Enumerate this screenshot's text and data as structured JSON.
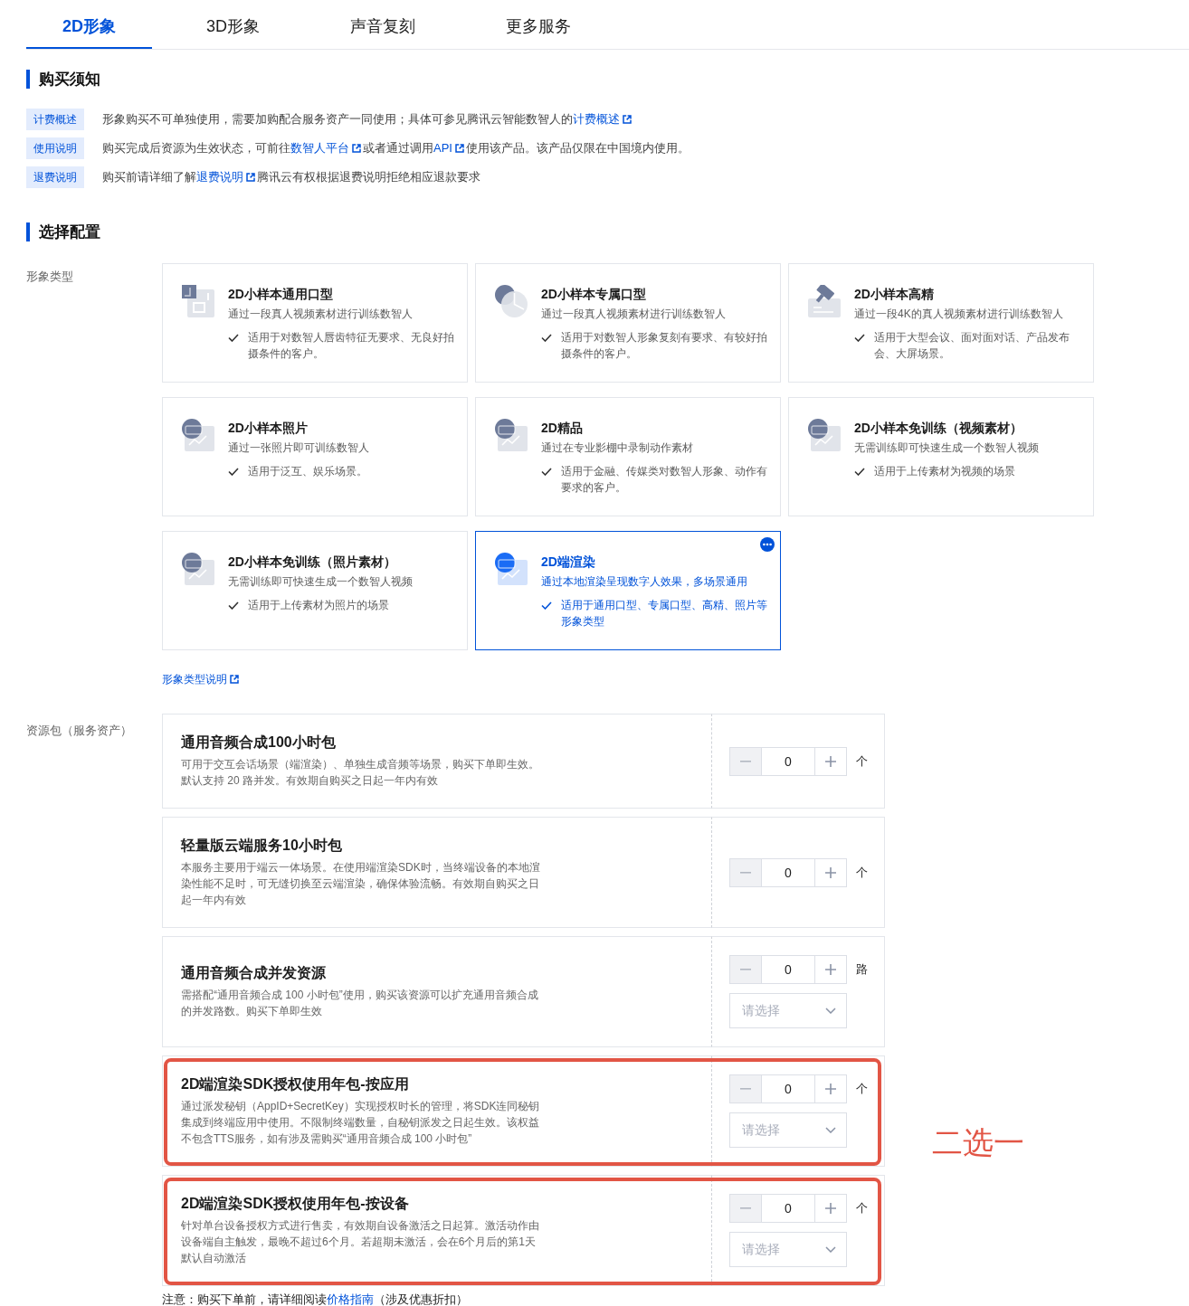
{
  "tabs": [
    {
      "label": "2D形象",
      "selected": true
    },
    {
      "label": "3D形象",
      "selected": false
    },
    {
      "label": "声音复刻",
      "selected": false
    },
    {
      "label": "更多服务",
      "selected": false
    }
  ],
  "purchase_notice": {
    "title": "购买须知",
    "items": [
      {
        "tag": "计费概述",
        "parts": [
          {
            "kind": "text",
            "text": "形象购买不可单独使用，需要加购配合服务资产一同使用；具体可参见腾讯云智能数智人的"
          },
          {
            "kind": "link",
            "text": "计费概述",
            "external": true
          }
        ]
      },
      {
        "tag": "使用说明",
        "parts": [
          {
            "kind": "text",
            "text": "购买完成后资源为生效状态，可前往"
          },
          {
            "kind": "link",
            "text": "数智人平台",
            "external": true
          },
          {
            "kind": "text",
            "text": "或者通过调用"
          },
          {
            "kind": "link",
            "text": "API",
            "external": true
          },
          {
            "kind": "text",
            "text": "使用该产品。该产品仅限在中国境内使用。"
          }
        ]
      },
      {
        "tag": "退费说明",
        "parts": [
          {
            "kind": "text",
            "text": "购买前请详细了解"
          },
          {
            "kind": "link",
            "text": "退费说明",
            "external": true
          },
          {
            "kind": "text",
            "text": "腾讯云有权根据退费说明拒绝相应退款要求"
          }
        ]
      }
    ]
  },
  "config": {
    "title": "选择配置",
    "avatar_type": {
      "label": "形象类型",
      "cards": [
        {
          "kind": "document",
          "title": "2D小样本通用口型",
          "description": "通过一段真人视频素材进行训练数智人",
          "feature": "适用于对数智人唇齿特征无要求、无良好拍摄条件的客户。",
          "selected": false
        },
        {
          "kind": "pie",
          "title": "2D小样本专属口型",
          "description": "通过一段真人视频素材进行训练数智人",
          "feature": "适用于对数智人形象复刻有要求、有较好拍摄条件的客户。",
          "selected": false
        },
        {
          "kind": "hammer",
          "title": "2D小样本高精",
          "description": "通过一段4K的真人视频素材进行训练数智人",
          "feature": "适用于大型会议、面对面对话、产品发布会、大屏场景。",
          "selected": false
        },
        {
          "kind": "image",
          "title": "2D小样本照片",
          "description": "通过一张照片即可训练数智人",
          "feature": "适用于泛互、娱乐场景。",
          "selected": false
        },
        {
          "kind": "image",
          "title": "2D精品",
          "description": "通过在专业影棚中录制动作素材",
          "feature": "适用于金融、传媒类对数智人形象、动作有要求的客户。",
          "selected": false
        },
        {
          "kind": "image",
          "title": "2D小样本免训练（视频素材）",
          "description": "无需训练即可快速生成一个数智人视频",
          "feature": "适用于上传素材为视频的场景",
          "selected": false
        },
        {
          "kind": "image",
          "title": "2D小样本免训练（照片素材）",
          "description": "无需训练即可快速生成一个数智人视频",
          "feature": "适用于上传素材为照片的场景",
          "selected": false
        },
        {
          "kind": "image",
          "title": "2D端渲染",
          "description": "通过本地渲染呈现数字人效果，多场景通用",
          "feature": "适用于通用口型、专属口型、高精、照片等形象类型",
          "selected": true
        }
      ],
      "help_link": {
        "text": "形象类型说明",
        "external": true
      }
    },
    "resource_packs": {
      "label": "资源包（服务资产）",
      "annotation": "二选一",
      "items": [
        {
          "title": "通用音频合成100小时包",
          "description": "可用于交互会话场景（端渲染）、单独生成音频等场景，购买下单即生效。默认支持 20 路并发。有效期自购买之日起一年内有效",
          "quantity": "0",
          "decrement_disabled": true,
          "unit": "个",
          "highlighted": false
        },
        {
          "title": "轻量版云端服务10小时包",
          "description": "本服务主要用于端云一体场景。在使用端渲染SDK时，当终端设备的本地渲染性能不足时，可无缝切换至云端渲染，确保体验流畅。有效期自购买之日起一年内有效",
          "quantity": "0",
          "decrement_disabled": true,
          "unit": "个",
          "highlighted": false
        },
        {
          "title": "通用音频合成并发资源",
          "description": "需搭配“通用音频合成 100 小时包”使用，购买该资源可以扩充通用音频合成的并发路数。购买下单即生效",
          "quantity": "0",
          "decrement_disabled": true,
          "unit": "路",
          "select": {
            "placeholder": "请选择"
          },
          "highlighted": false
        },
        {
          "title": "2D端渲染SDK授权使用年包-按应用",
          "description": "通过派发秘钥（AppID+SecretKey）实现授权时长的管理，将SDK连同秘钥集成到终端应用中使用。不限制终端数量，自秘钥派发之日起生效。该权益不包含TTS服务，如有涉及需购买“通用音频合成 100 小时包”",
          "quantity": "0",
          "decrement_disabled": true,
          "unit": "个",
          "select": {
            "placeholder": "请选择"
          },
          "highlighted": true
        },
        {
          "title": "2D端渲染SDK授权使用年包-按设备",
          "description": "针对单台设备授权方式进行售卖，有效期自设备激活之日起算。激活动作由设备端自主触发，最晚不超过6个月。若超期未激活，会在6个月后的第1天默认自动激活",
          "quantity": "0",
          "decrement_disabled": true,
          "unit": "个",
          "select": {
            "placeholder": "请选择"
          },
          "highlighted": true
        }
      ]
    }
  },
  "note": {
    "parts": [
      {
        "kind": "text",
        "text": "注意：购买下单前，请详细阅读"
      },
      {
        "kind": "link",
        "text": "价格指南",
        "external": false
      },
      {
        "kind": "text",
        "text": "（涉及优惠折扣）"
      }
    ]
  }
}
